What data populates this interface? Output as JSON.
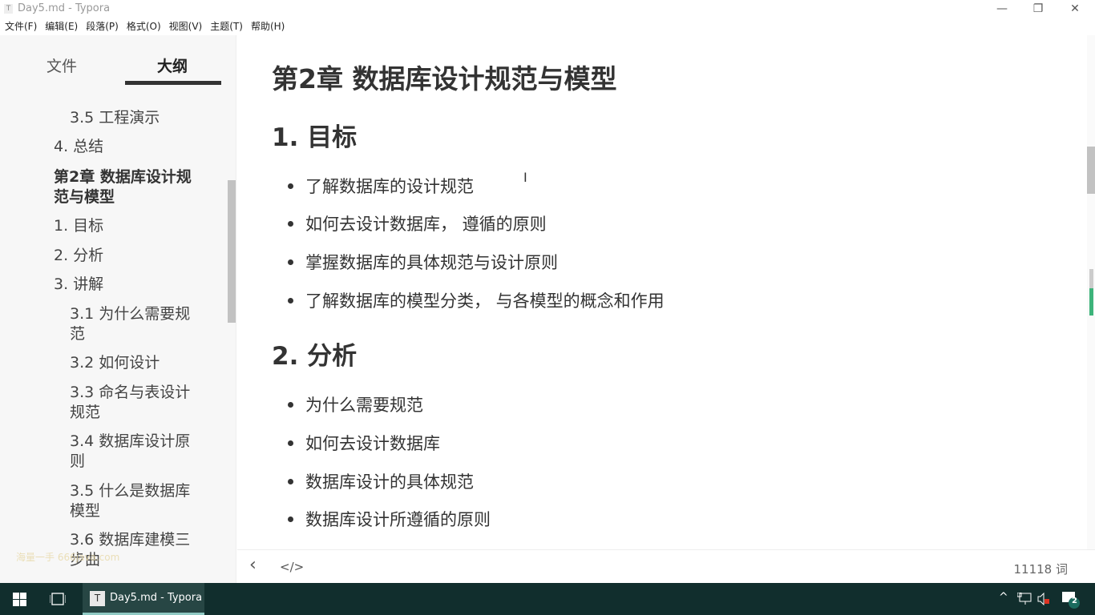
{
  "window": {
    "title": "Day5.md - Typora",
    "app_icon": "T",
    "minimize": "—",
    "restore": "❐",
    "close": "✕"
  },
  "menu": [
    "文件(F)",
    "编辑(E)",
    "段落(P)",
    "格式(O)",
    "视图(V)",
    "主题(T)",
    "帮助(H)"
  ],
  "sidebar": {
    "tabs": [
      "文件",
      "大纲"
    ],
    "active_tab": "大纲",
    "outline": [
      {
        "label": "3.5 工程演示",
        "level": 3
      },
      {
        "label": "4. 总结",
        "level": 2
      },
      {
        "label": "第2章 数据库设计规范与模型",
        "level": 1
      },
      {
        "label": "1. 目标",
        "level": 2
      },
      {
        "label": "2. 分析",
        "level": 2
      },
      {
        "label": "3. 讲解",
        "level": 2
      },
      {
        "label": "3.1 为什么需要规范",
        "level": 3
      },
      {
        "label": "3.2 如何设计",
        "level": 3
      },
      {
        "label": "3.3 命名与表设计规范",
        "level": 3
      },
      {
        "label": "3.4 数据库设计原则",
        "level": 3
      },
      {
        "label": "3.5 什么是数据库模型",
        "level": 3
      },
      {
        "label": "3.6 数据库建模三步曲",
        "level": 3
      }
    ],
    "watermark": "海量一手 666java.com"
  },
  "document": {
    "h1": "第2章 数据库设计规范与模型",
    "sections": [
      {
        "heading": "1. 目标",
        "items": [
          "了解数据库的设计规范",
          "如何去设计数据库， 遵循的原则",
          "掌握数据库的具体规范与设计原则",
          "了解数据库的模型分类， 与各模型的概念和作用"
        ]
      },
      {
        "heading": "2. 分析",
        "items": [
          "为什么需要规范",
          "如何去设计数据库",
          "数据库设计的具体规范",
          "数据库设计所遵循的原则"
        ]
      }
    ],
    "cursor": "I"
  },
  "footer": {
    "back": "‹",
    "source_mode": "</>",
    "word_count": "11118 词"
  },
  "taskbar": {
    "app_label": "Day5.md - Typora",
    "app_icon": "T",
    "notification_count": "2",
    "accent": "#112e2d"
  }
}
